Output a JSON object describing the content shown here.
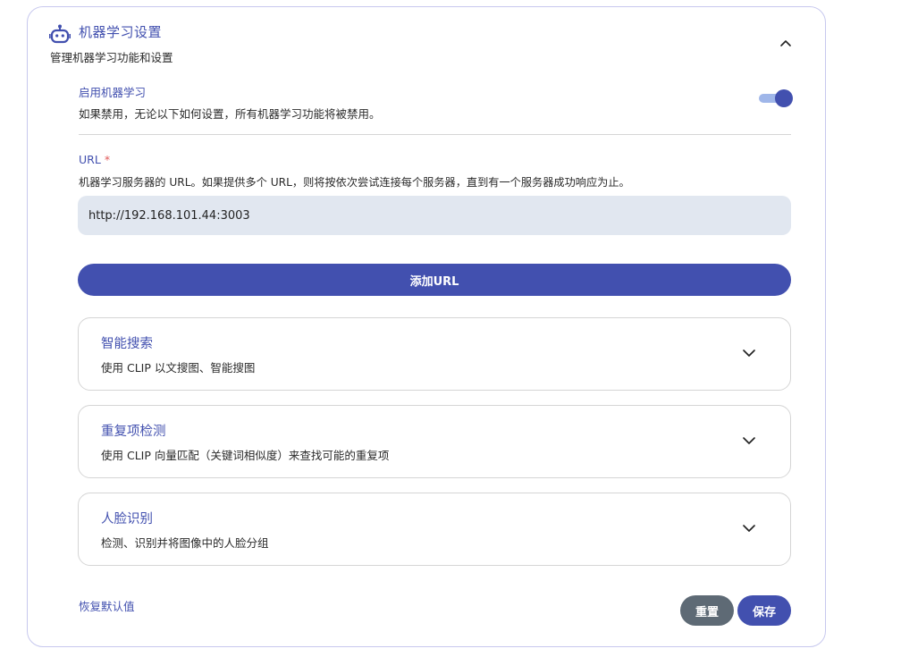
{
  "header": {
    "icon": "robot-icon",
    "title": "机器学习设置",
    "subtitle": "管理机器学习功能和设置",
    "collapse_icon": "chevron-up-icon"
  },
  "enable_ml": {
    "label": "启用机器学习",
    "description": "如果禁用，无论以下如何设置，所有机器学习功能将被禁用。",
    "enabled": true
  },
  "url_field": {
    "label": "URL",
    "required_mark": "*",
    "description": "机器学习服务器的 URL。如果提供多个 URL，则将按依次尝试连接每个服务器，直到有一个服务器成功响应为止。",
    "value": "http://192.168.101.44:3003"
  },
  "add_url_label": "添加URL",
  "sections": [
    {
      "title": "智能搜索",
      "description": "使用 CLIP 以文搜图、智能搜图",
      "icon": "chevron-down-icon"
    },
    {
      "title": "重复项检测",
      "description": "使用 CLIP 向量匹配（关键词相似度）来查找可能的重复项",
      "icon": "chevron-down-icon"
    },
    {
      "title": "人脸识别",
      "description": "检测、识别并将图像中的人脸分组",
      "icon": "chevron-down-icon"
    }
  ],
  "footer": {
    "restore_label": "恢复默认值",
    "reset_label": "重置",
    "save_label": "保存"
  },
  "colors": {
    "accent": "#4250af",
    "reset_button": "#5e6a75",
    "input_background": "#e1e7f0",
    "required": "#e15a5a"
  }
}
